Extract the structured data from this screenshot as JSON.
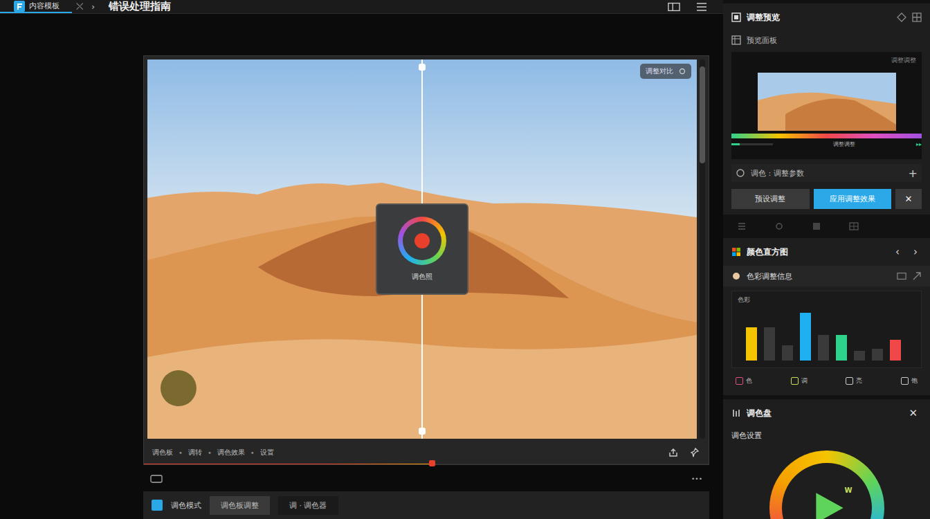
{
  "app_tab": {
    "label": "内容模板",
    "selected": true
  },
  "nav": {
    "close": "⤬",
    "next": "›"
  },
  "window": {
    "title": "错误处理指南"
  },
  "canvas": {
    "badge": "调整对比",
    "overlay_label": "调色照",
    "split_level": 0.5,
    "progress_level": 0.51
  },
  "canvas_toolbar": {
    "items": [
      "调色板",
      "调转",
      "调色效果",
      "设置"
    ],
    "separator": "•"
  },
  "below_canvas": {
    "more": "•••"
  },
  "bottom_toolbar": {
    "label": "调色模式",
    "tabs": [
      {
        "label": "调色板调整",
        "selected": true
      },
      {
        "label": "调 · 调色器",
        "selected": false
      }
    ]
  },
  "preview_panel": {
    "title": "调整预览",
    "subtitle": "预览面板",
    "corner": "调整调整",
    "reading": "调整调整",
    "play": "▸▸",
    "search": "调色 : 调整参数",
    "add": "+",
    "buttons": [
      {
        "label": "预设调整",
        "selected": false
      },
      {
        "label": "应用调整效果",
        "selected": true
      }
    ],
    "close": "✕",
    "timeline_level": 0.2
  },
  "histogram": {
    "title": "颜色直方图",
    "prev": "‹",
    "next": "›",
    "subtitle": "色彩调整信息",
    "axis_label": "色彩",
    "bars": [
      {
        "value": 62,
        "color": "#f5c400"
      },
      {
        "value": 62,
        "color": "#3a3a3a"
      },
      {
        "value": 28,
        "color": "#3a3a3a"
      },
      {
        "value": 88,
        "color": "#1eb0f0"
      },
      {
        "value": 48,
        "color": "#3a3a3a"
      },
      {
        "value": 48,
        "color": "#2fd28a"
      },
      {
        "value": 18,
        "color": "#3a3a3a"
      },
      {
        "value": 22,
        "color": "#3a3a3a"
      },
      {
        "value": 38,
        "color": "#f04848"
      }
    ],
    "legend": [
      {
        "label": "色",
        "color": "#e05080"
      },
      {
        "label": "调",
        "color": "#c8e060"
      },
      {
        "label": "亮",
        "color": "#cccccc"
      },
      {
        "label": "饱",
        "color": "#cccccc"
      }
    ]
  },
  "palette": {
    "title": "调色盘",
    "close": "✕",
    "subtitle": "调色设置",
    "play_badge": "W"
  }
}
